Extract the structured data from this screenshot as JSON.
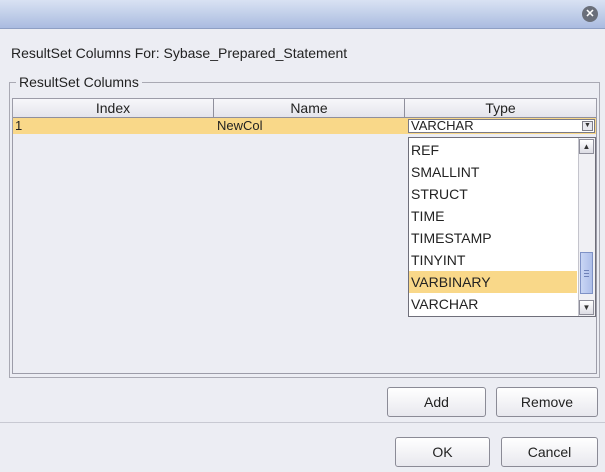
{
  "dialog": {
    "close_glyph": "✕",
    "header_label": "ResultSet Columns For:  Sybase_Prepared_Statement",
    "group_title": "ResultSet Columns"
  },
  "table": {
    "columns": [
      "Index",
      "Name",
      "Type"
    ],
    "rows": [
      {
        "index": "1",
        "name": "NewCol",
        "type": "VARCHAR"
      }
    ],
    "selected_row_color": "#f9d889"
  },
  "type_dropdown": {
    "selected_value": "VARCHAR",
    "visible_options": [
      "REF",
      "SMALLINT",
      "STRUCT",
      "TIME",
      "TIMESTAMP",
      "TINYINT",
      "VARBINARY",
      "VARCHAR"
    ],
    "highlighted_option": "VARBINARY",
    "arrow_icon": "chevron-down-icon"
  },
  "buttons": {
    "add": "Add",
    "remove": "Remove",
    "ok": "OK",
    "cancel": "Cancel"
  }
}
